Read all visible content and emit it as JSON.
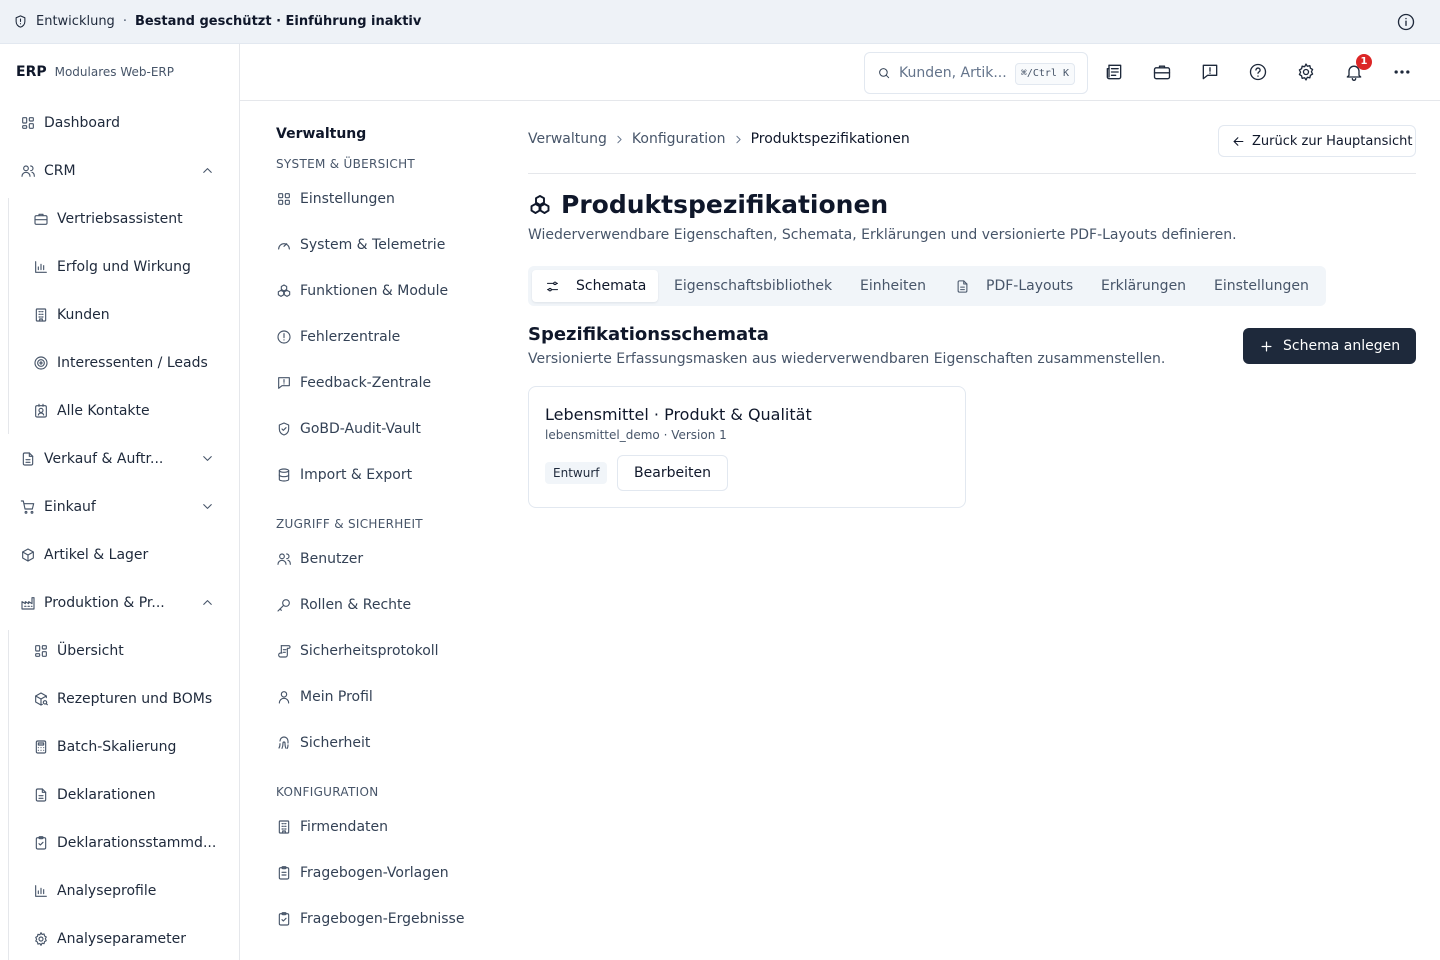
{
  "banner": {
    "environment": "Entwicklung",
    "separator": "·",
    "status": "Bestand geschützt · Einführung inaktiv"
  },
  "brand": {
    "name": "ERP",
    "subtitle": "Modulares Web-ERP"
  },
  "sidebar": {
    "items": [
      {
        "label": "Dashboard",
        "icon": "dashboard-icon"
      },
      {
        "label": "CRM",
        "icon": "users-icon",
        "expanded": true
      },
      {
        "label": "Vertriebsassistent",
        "icon": "briefcase-icon"
      },
      {
        "label": "Erfolg und Wirkung",
        "icon": "bar-chart-icon"
      },
      {
        "label": "Kunden",
        "icon": "building-icon"
      },
      {
        "label": "Interessenten / Leads",
        "icon": "target-icon"
      },
      {
        "label": "Alle Kontakte",
        "icon": "contact-icon"
      },
      {
        "label": "Verkauf & Auftr...",
        "icon": "file-icon",
        "expanded": false
      },
      {
        "label": "Einkauf",
        "icon": "cart-icon",
        "expanded": false
      },
      {
        "label": "Artikel & Lager",
        "icon": "package-icon"
      },
      {
        "label": "Produktion & Pr...",
        "icon": "factory-icon",
        "expanded": true
      },
      {
        "label": "Übersicht",
        "icon": "dashboard-icon"
      },
      {
        "label": "Rezepturen und BOMs",
        "icon": "package-search-icon"
      },
      {
        "label": "Batch-Skalierung",
        "icon": "calculator-icon"
      },
      {
        "label": "Deklarationen",
        "icon": "file-text-icon"
      },
      {
        "label": "Deklarationsstammd...",
        "icon": "clipboard-icon"
      },
      {
        "label": "Analyseprofile",
        "icon": "bar-chart-icon"
      },
      {
        "label": "Analyseparameter",
        "icon": "gear-icon"
      }
    ]
  },
  "header": {
    "search_placeholder": "Kunden, Artik...",
    "shortcut": "⌘/Ctrl K",
    "notification_count": "1"
  },
  "settings_nav": {
    "title": "Verwaltung",
    "groups": [
      {
        "label": "SYSTEM & ÜBERSICHT",
        "items": [
          {
            "label": "Einstellungen",
            "icon": "grid-icon"
          },
          {
            "label": "System & Telemetrie",
            "icon": "gauge-icon"
          },
          {
            "label": "Funktionen & Module",
            "icon": "boxes-icon"
          },
          {
            "label": "Fehlerzentrale",
            "icon": "alert-circle-icon"
          },
          {
            "label": "Feedback-Zentrale",
            "icon": "message-alert-icon"
          },
          {
            "label": "GoBD-Audit-Vault",
            "icon": "shield-check-icon"
          },
          {
            "label": "Import & Export",
            "icon": "database-icon"
          }
        ]
      },
      {
        "label": "ZUGRIFF & SICHERHEIT",
        "items": [
          {
            "label": "Benutzer",
            "icon": "users-icon"
          },
          {
            "label": "Rollen & Rechte",
            "icon": "key-icon"
          },
          {
            "label": "Sicherheitsprotokoll",
            "icon": "scroll-icon"
          },
          {
            "label": "Mein Profil",
            "icon": "user-icon"
          },
          {
            "label": "Sicherheit",
            "icon": "fingerprint-icon"
          }
        ]
      },
      {
        "label": "KONFIGURATION",
        "items": [
          {
            "label": "Firmendaten",
            "icon": "building-icon"
          },
          {
            "label": "Fragebogen-Vorlagen",
            "icon": "clipboard-list-icon"
          },
          {
            "label": "Fragebogen-Ergebnisse",
            "icon": "clipboard-check-icon"
          }
        ]
      }
    ]
  },
  "breadcrumb": [
    "Verwaltung",
    "Konfiguration",
    "Produktspezifikationen"
  ],
  "back_button": "Zurück zur Hauptansicht",
  "page": {
    "title": "Produktspezifikationen",
    "subtitle": "Wiederverwendbare Eigenschaften, Schemata, Erklärungen und versionierte PDF-Layouts definieren."
  },
  "tabs": [
    {
      "label": "Schemata",
      "active": true,
      "icon": "sliders-icon"
    },
    {
      "label": "Eigenschaftsbibliothek"
    },
    {
      "label": "Einheiten"
    },
    {
      "label": "PDF-Layouts",
      "icon": "file-icon"
    },
    {
      "label": "Erklärungen"
    },
    {
      "label": "Einstellungen"
    }
  ],
  "section": {
    "title": "Spezifikationsschemata",
    "subtitle": "Versionierte Erfassungsmasken aus wiederverwendbaren Eigenschaften zusammenstellen.",
    "create_button": "Schema anlegen"
  },
  "schema_card": {
    "title": "Lebensmittel · Produkt & Qualität",
    "meta": "lebensmittel_demo · Version 1",
    "status": "Entwurf",
    "edit_button": "Bearbeiten"
  },
  "colors": {
    "primary": "#1e293b",
    "banner_bg": "#eef2f7",
    "badge": "#dc2626",
    "border": "#e2e8f0"
  }
}
